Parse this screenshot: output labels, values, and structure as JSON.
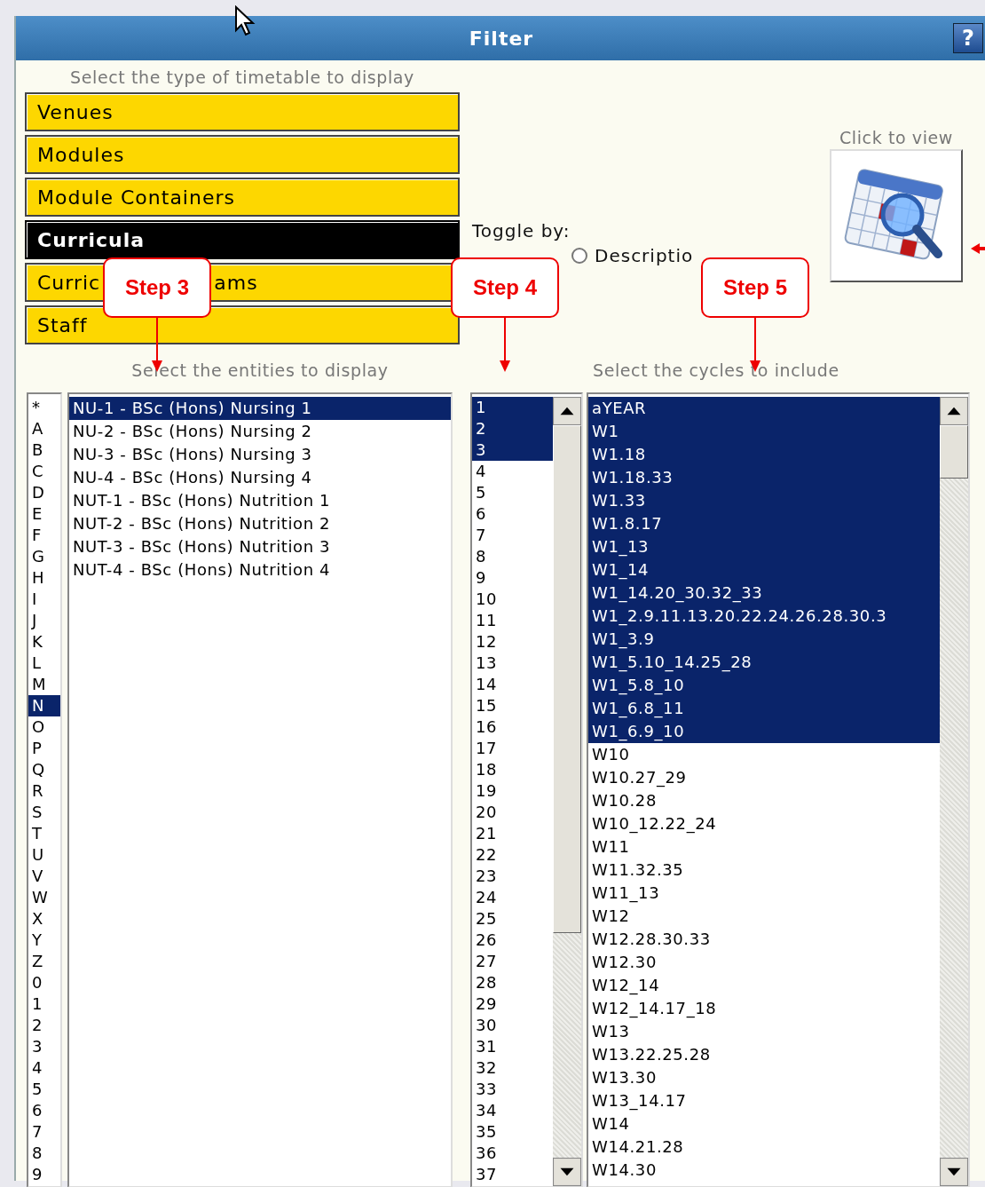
{
  "window": {
    "title": "Filter",
    "help_label": "?"
  },
  "timetable_types": {
    "caption": "Select the type of timetable to display",
    "items": [
      {
        "label": "Venues",
        "selected": false
      },
      {
        "label": "Modules",
        "selected": false
      },
      {
        "label": "Module Containers",
        "selected": false
      },
      {
        "label": "Curricula",
        "selected": true
      },
      {
        "label": "Curric",
        "label_end": "ams",
        "selected": false
      },
      {
        "label": "Staff",
        "selected": false
      }
    ]
  },
  "toggle": {
    "label": "Toggle by:",
    "options": [
      {
        "label": "Descriptio",
        "selected": false
      }
    ]
  },
  "viewer": {
    "caption": "Click to view"
  },
  "callouts": [
    {
      "label": "Step 3"
    },
    {
      "label": "Step 4"
    },
    {
      "label": "Step 5"
    }
  ],
  "entities": {
    "caption": "Select the entities to display",
    "letters": [
      {
        "label": "*",
        "selected": false
      },
      {
        "label": "A",
        "selected": false
      },
      {
        "label": "B",
        "selected": false
      },
      {
        "label": "C",
        "selected": false
      },
      {
        "label": "D",
        "selected": false
      },
      {
        "label": "E",
        "selected": false
      },
      {
        "label": "F",
        "selected": false
      },
      {
        "label": "G",
        "selected": false
      },
      {
        "label": "H",
        "selected": false
      },
      {
        "label": "I",
        "selected": false
      },
      {
        "label": "J",
        "selected": false
      },
      {
        "label": "K",
        "selected": false
      },
      {
        "label": "L",
        "selected": false
      },
      {
        "label": "M",
        "selected": false
      },
      {
        "label": "N",
        "selected": true
      },
      {
        "label": "O",
        "selected": false
      },
      {
        "label": "P",
        "selected": false
      },
      {
        "label": "Q",
        "selected": false
      },
      {
        "label": "R",
        "selected": false
      },
      {
        "label": "S",
        "selected": false
      },
      {
        "label": "T",
        "selected": false
      },
      {
        "label": "U",
        "selected": false
      },
      {
        "label": "V",
        "selected": false
      },
      {
        "label": "W",
        "selected": false
      },
      {
        "label": "X",
        "selected": false
      },
      {
        "label": "Y",
        "selected": false
      },
      {
        "label": "Z",
        "selected": false
      },
      {
        "label": "0",
        "selected": false
      },
      {
        "label": "1",
        "selected": false
      },
      {
        "label": "2",
        "selected": false
      },
      {
        "label": "3",
        "selected": false
      },
      {
        "label": "4",
        "selected": false
      },
      {
        "label": "5",
        "selected": false
      },
      {
        "label": "6",
        "selected": false
      },
      {
        "label": "7",
        "selected": false
      },
      {
        "label": "8",
        "selected": false
      },
      {
        "label": "9",
        "selected": false
      }
    ],
    "items": [
      {
        "label": "NU-1 - BSc (Hons) Nursing 1",
        "selected": true
      },
      {
        "label": "NU-2 - BSc (Hons) Nursing 2",
        "selected": false
      },
      {
        "label": "NU-3 - BSc (Hons) Nursing 3",
        "selected": false
      },
      {
        "label": "NU-4 - BSc (Hons) Nursing 4",
        "selected": false
      },
      {
        "label": "NUT-1 - BSc (Hons) Nutrition 1",
        "selected": false
      },
      {
        "label": "NUT-2 - BSc (Hons) Nutrition 2",
        "selected": false
      },
      {
        "label": "NUT-3 - BSc (Hons) Nutrition 3",
        "selected": false
      },
      {
        "label": "NUT-4 - BSc (Hons) Nutrition 4",
        "selected": false
      }
    ]
  },
  "weeks": [
    {
      "label": "1",
      "selected": true
    },
    {
      "label": "2",
      "selected": true
    },
    {
      "label": "3",
      "selected": true
    },
    {
      "label": "4",
      "selected": false
    },
    {
      "label": "5",
      "selected": false
    },
    {
      "label": "6",
      "selected": false
    },
    {
      "label": "7",
      "selected": false
    },
    {
      "label": "8",
      "selected": false
    },
    {
      "label": "9",
      "selected": false
    },
    {
      "label": "10",
      "selected": false
    },
    {
      "label": "11",
      "selected": false
    },
    {
      "label": "12",
      "selected": false
    },
    {
      "label": "13",
      "selected": false
    },
    {
      "label": "14",
      "selected": false
    },
    {
      "label": "15",
      "selected": false
    },
    {
      "label": "16",
      "selected": false
    },
    {
      "label": "17",
      "selected": false
    },
    {
      "label": "18",
      "selected": false
    },
    {
      "label": "19",
      "selected": false
    },
    {
      "label": "20",
      "selected": false
    },
    {
      "label": "21",
      "selected": false
    },
    {
      "label": "22",
      "selected": false
    },
    {
      "label": "23",
      "selected": false
    },
    {
      "label": "24",
      "selected": false
    },
    {
      "label": "25",
      "selected": false
    },
    {
      "label": "26",
      "selected": false
    },
    {
      "label": "27",
      "selected": false
    },
    {
      "label": "28",
      "selected": false
    },
    {
      "label": "29",
      "selected": false
    },
    {
      "label": "30",
      "selected": false
    },
    {
      "label": "31",
      "selected": false
    },
    {
      "label": "32",
      "selected": false
    },
    {
      "label": "33",
      "selected": false
    },
    {
      "label": "34",
      "selected": false
    },
    {
      "label": "35",
      "selected": false
    },
    {
      "label": "36",
      "selected": false
    },
    {
      "label": "37",
      "selected": false
    }
  ],
  "cycles": {
    "caption": "Select the cycles to include",
    "items": [
      {
        "label": "aYEAR",
        "selected": true
      },
      {
        "label": "W1",
        "selected": true
      },
      {
        "label": "W1.18",
        "selected": true
      },
      {
        "label": "W1.18.33",
        "selected": true
      },
      {
        "label": "W1.33",
        "selected": true
      },
      {
        "label": "W1.8.17",
        "selected": true
      },
      {
        "label": "W1_13",
        "selected": true
      },
      {
        "label": "W1_14",
        "selected": true
      },
      {
        "label": "W1_14.20_30.32_33",
        "selected": true
      },
      {
        "label": "W1_2.9.11.13.20.22.24.26.28.30.3",
        "selected": true
      },
      {
        "label": "W1_3.9",
        "selected": true
      },
      {
        "label": "W1_5.10_14.25_28",
        "selected": true
      },
      {
        "label": "W1_5.8_10",
        "selected": true
      },
      {
        "label": "W1_6.8_11",
        "selected": true
      },
      {
        "label": "W1_6.9_10",
        "selected": true
      },
      {
        "label": "W10",
        "selected": false
      },
      {
        "label": "W10.27_29",
        "selected": false
      },
      {
        "label": "W10.28",
        "selected": false
      },
      {
        "label": "W10_12.22_24",
        "selected": false
      },
      {
        "label": "W11",
        "selected": false
      },
      {
        "label": "W11.32.35",
        "selected": false
      },
      {
        "label": "W11_13",
        "selected": false
      },
      {
        "label": "W12",
        "selected": false
      },
      {
        "label": "W12.28.30.33",
        "selected": false
      },
      {
        "label": "W12.30",
        "selected": false
      },
      {
        "label": "W12_14",
        "selected": false
      },
      {
        "label": "W12_14.17_18",
        "selected": false
      },
      {
        "label": "W13",
        "selected": false
      },
      {
        "label": "W13.22.25.28",
        "selected": false
      },
      {
        "label": "W13.30",
        "selected": false
      },
      {
        "label": "W13_14.17",
        "selected": false
      },
      {
        "label": "W14",
        "selected": false
      },
      {
        "label": "W14.21.28",
        "selected": false
      },
      {
        "label": "W14.30",
        "selected": false
      }
    ]
  }
}
